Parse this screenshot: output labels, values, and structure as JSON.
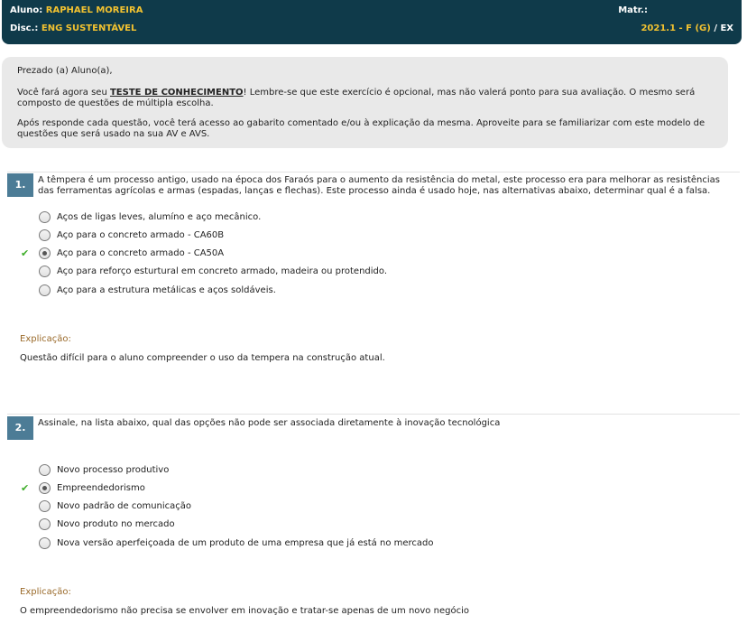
{
  "header": {
    "aluno_label": "Aluno:",
    "aluno_value": "RAPHAEL MOREIRA",
    "matr_label": "Matr.:",
    "disc_label": "Disc.:",
    "disc_value": "ENG SUSTENTÁVEL",
    "period": "2021.1 - F (G)",
    "sep": "/",
    "mode": "EX"
  },
  "notice": {
    "greeting": "Prezado (a) Aluno(a),",
    "p1_pre": "Você fará agora seu ",
    "p1_bold": "TESTE DE CONHECIMENTO",
    "p1_post": "! Lembre-se que este exercício é opcional, mas não valerá ponto para sua avaliação. O mesmo será composto de questões de múltipla escolha.",
    "p2": "Após responde cada questão, você terá acesso ao gabarito comentado e/ou à explicação da mesma. Aproveite para se familiarizar com este modelo de questões que será usado na sua AV e AVS."
  },
  "questions": [
    {
      "number": "1.",
      "text": "A têmpera é um processo antigo, usado na época dos Faraós para o aumento da resistência do metal, este processo era para melhorar as resistências das ferramentas agrícolas e armas (espadas, lanças e flechas). Este processo ainda é usado hoje, nas alternativas abaixo, determinar qual é a falsa.",
      "options": [
        "Aços de ligas leves, alumíno e aço mecânico.",
        "Aço para o concreto armado - CA60B",
        "Aço para o concreto armado - CA50A",
        "Aço para reforço esturtural em concreto armado, madeira ou protendido.",
        "Aço para a estrutura metálicas e aços soldáveis."
      ],
      "selected_index": 2,
      "explanation_label": "Explicação:",
      "explanation": "Questão difícil para o aluno compreender o uso da tempera na construção atual."
    },
    {
      "number": "2.",
      "text": "Assinale, na lista abaixo, qual das opções não pode ser associada diretamente à inovação tecnológica",
      "options": [
        "Novo processo produtivo",
        "Empreendedorismo",
        "Novo padrão de comunicação",
        "Novo produto no mercado",
        "Nova versão aperfeiçoada de um produto de uma empresa que já está no mercado"
      ],
      "selected_index": 1,
      "explanation_label": "Explicação:",
      "explanation": "O empreendedorismo não precisa se envolver em inovação e tratar-se apenas de um novo negócio"
    }
  ],
  "icons": {
    "check": "checkmark-icon",
    "check_color": "#3fae2a"
  }
}
